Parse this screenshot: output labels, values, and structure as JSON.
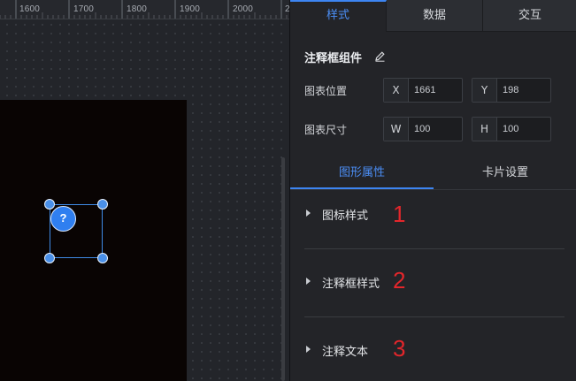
{
  "ruler": {
    "labels": [
      "1600",
      "1700",
      "1800",
      "1900",
      "2000",
      "2"
    ]
  },
  "canvas": {
    "selected_component": {
      "icon": "question-mark-icon",
      "glyph": "?"
    }
  },
  "panel": {
    "tabs": [
      {
        "label": "样式",
        "active": true
      },
      {
        "label": "数据",
        "active": false
      },
      {
        "label": "交互",
        "active": false
      }
    ],
    "component_title": "注释框组件",
    "position": {
      "label": "图表位置",
      "x_prefix": "X",
      "x_value": "1661",
      "y_prefix": "Y",
      "y_value": "198"
    },
    "size": {
      "label": "图表尺寸",
      "w_prefix": "W",
      "w_value": "100",
      "h_prefix": "H",
      "h_value": "100"
    },
    "sub_tabs": [
      {
        "label": "图形属性",
        "active": true
      },
      {
        "label": "卡片设置",
        "active": false
      }
    ],
    "sections": [
      {
        "label": "图标样式",
        "number": "1"
      },
      {
        "label": "注释框样式",
        "number": "2"
      },
      {
        "label": "注释文本",
        "number": "3"
      }
    ]
  },
  "colors": {
    "accent": "#3d85f2",
    "annotation_red": "#e3262b",
    "panel_bg": "#232428",
    "artboard_bg": "#090403"
  }
}
